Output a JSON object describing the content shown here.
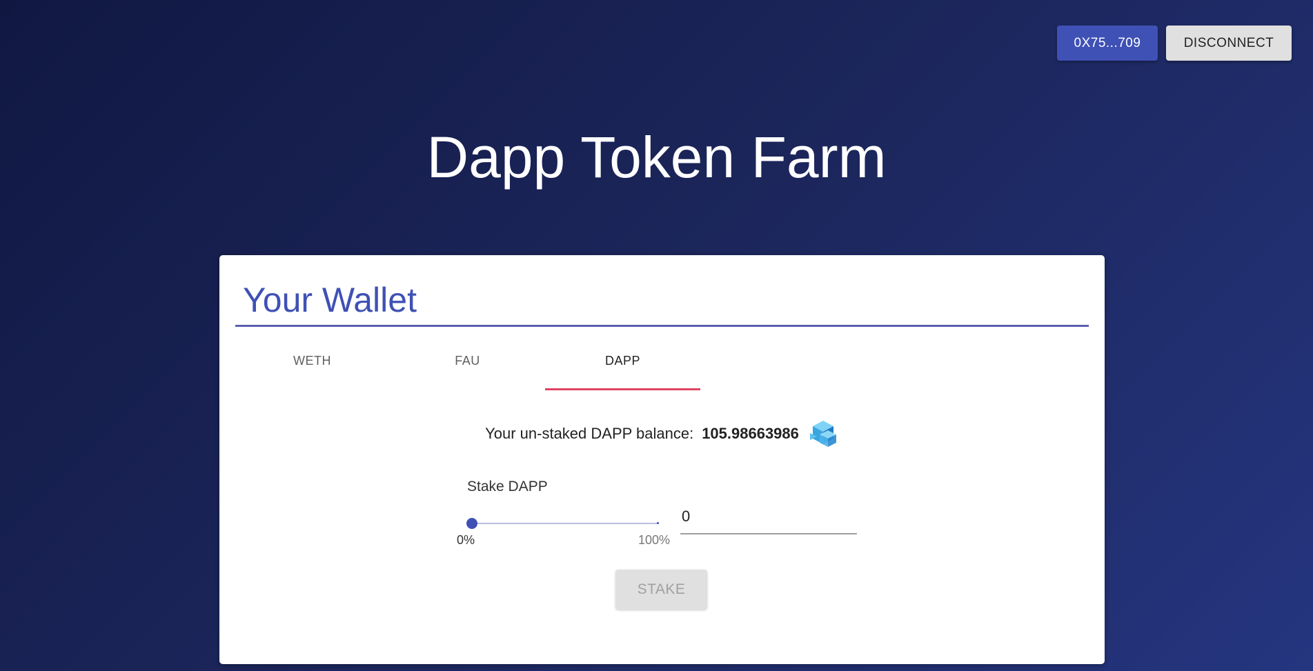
{
  "header": {
    "account_label": "0X75...709",
    "disconnect_label": "DISCONNECT"
  },
  "app": {
    "title": "Dapp Token Farm"
  },
  "wallet": {
    "title": "Your Wallet",
    "tabs": [
      {
        "label": "WETH",
        "active": false
      },
      {
        "label": "FAU",
        "active": false
      },
      {
        "label": "DAPP",
        "active": true
      }
    ],
    "balance_label": "Your un-staked DAPP balance:",
    "balance_value": "105.98663986",
    "token_icon": "dapp-token-icon",
    "stake_label": "Stake DAPP",
    "slider": {
      "min_label": "0%",
      "max_label": "100%",
      "value_fraction": 0
    },
    "amount_value": "0",
    "stake_button_label": "STAKE"
  },
  "colors": {
    "primary": "#3f51b5",
    "tab_indicator": "#e04360",
    "background_start": "#101842",
    "background_end": "#25357f"
  }
}
